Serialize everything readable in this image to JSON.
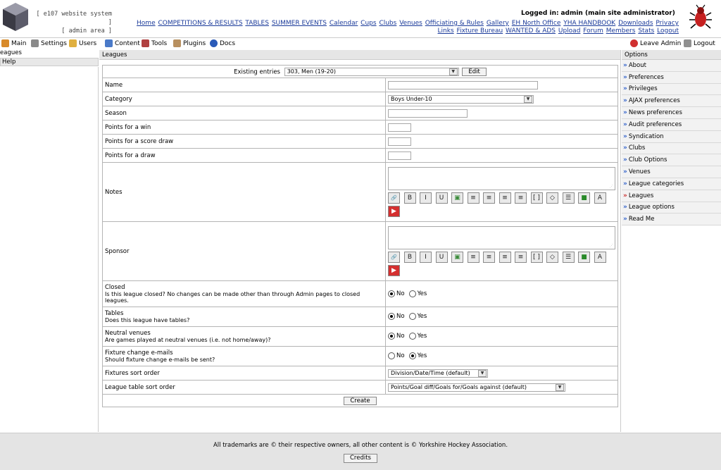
{
  "header": {
    "system_title_line1": "[ e107 website system ]",
    "system_title_line2": "[ admin area ]",
    "logged_in_label": "Logged in:",
    "logged_in_user": "admin (main site administrator)",
    "links_row1": [
      "Home",
      "COMPETITIONS & RESULTS",
      "TABLES",
      "SUMMER EVENTS",
      "Calendar",
      "Cups",
      "Clubs",
      "Venues",
      "Officiating & Rules",
      "Gallery",
      "EH North Office",
      "YHA HANDBOOK",
      "Downloads",
      "Privacy"
    ],
    "links_row2": [
      "Links",
      "Fixture Bureau",
      "WANTED & ADS",
      "Upload",
      "Forum",
      "Members",
      "Stats",
      "Logout"
    ]
  },
  "menubar": {
    "main": "Main",
    "settings": "Settings",
    "users": "Users",
    "content": "Content",
    "tools": "Tools",
    "plugins": "Plugins",
    "docs": "Docs",
    "leave_admin": "Leave Admin",
    "logout": "Logout"
  },
  "left": {
    "caption": "eagues",
    "help": "Help"
  },
  "main": {
    "caption": "Leagues",
    "existing_label": "Existing entries",
    "existing_value": "303, Men (19-20)",
    "edit_button": "Edit",
    "fields": {
      "name": "Name",
      "category": "Category",
      "category_value": "Boys Under-10",
      "season": "Season",
      "points_win": "Points for a win",
      "points_score_draw": "Points for a score draw",
      "points_draw": "Points for a draw",
      "notes": "Notes",
      "sponsor": "Sponsor",
      "closed": "Closed",
      "closed_help": "Is this league closed? No changes can be made other than through Admin pages to closed leagues.",
      "tables": "Tables",
      "tables_help": "Does this league have tables?",
      "neutral": "Neutral venues",
      "neutral_help": "Are games played at neutral venues (i.e. not home/away)?",
      "fixture_email": "Fixture change e-mails",
      "fixture_email_help": "Should fixture change e-mails be sent?",
      "fixtures_sort": "Fixtures sort order",
      "fixtures_sort_value": "Division/Date/Time (default)",
      "table_sort": "League table sort order",
      "table_sort_value": "Points/Goal diff/Goals for/Goals against (default)"
    },
    "radio_no": "No",
    "radio_yes": "Yes",
    "radio_state": {
      "closed": "No",
      "tables": "No",
      "neutral": "No",
      "fixture_email": "Yes"
    },
    "toolbar_icons": [
      "link-icon",
      "bold-icon",
      "italic-icon",
      "underline-icon",
      "image-icon",
      "align-center-icon",
      "align-left-icon",
      "align-right-icon",
      "justify-icon",
      "code-icon",
      "flash-icon",
      "list-icon",
      "color-icon",
      "font-icon",
      "youtube-icon"
    ],
    "toolbar_glyphs": [
      "🔗",
      "B",
      "I",
      "U",
      "▣",
      "≡",
      "≡",
      "≡",
      "≡",
      "[ ]",
      "◇",
      "☰",
      "■",
      "A",
      "▶"
    ],
    "create_button": "Create"
  },
  "options": {
    "caption": "Options",
    "items": [
      "About",
      "Preferences",
      "Privileges",
      "AJAX preferences",
      "News preferences",
      "Audit preferences",
      "Syndication",
      "Clubs",
      "Club Options",
      "Venues",
      "League categories",
      "Leagues",
      "League options",
      "Read Me"
    ],
    "active_index": 11
  },
  "footer": {
    "text": "All trademarks are © their respective owners, all other content is © Yorkshire Hockey Association.",
    "credits_button": "Credits"
  }
}
